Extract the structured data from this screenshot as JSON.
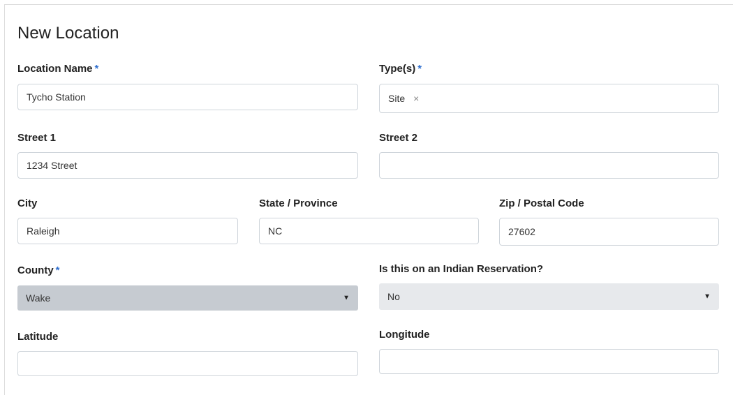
{
  "title": "New Location",
  "required_marker": "*",
  "fields": {
    "location_name": {
      "label": "Location Name",
      "value": "Tycho Station"
    },
    "types": {
      "label": "Type(s)",
      "tags": [
        {
          "label": "Site",
          "remove_icon": "×"
        }
      ]
    },
    "street1": {
      "label": "Street 1",
      "value": "1234 Street"
    },
    "street2": {
      "label": "Street 2",
      "value": ""
    },
    "city": {
      "label": "City",
      "value": "Raleigh"
    },
    "state": {
      "label": "State / Province",
      "value": "NC"
    },
    "zip": {
      "label": "Zip / Postal Code",
      "value": "27602"
    },
    "county": {
      "label": "County",
      "value": "Wake",
      "arrow": "▼",
      "bg_color": "#c6cbd1"
    },
    "reservation": {
      "label": "Is this on an Indian Reservation?",
      "value": "No",
      "arrow": "▼",
      "bg_color": "#e7e9ec"
    },
    "latitude": {
      "label": "Latitude",
      "value": ""
    },
    "longitude": {
      "label": "Longitude",
      "value": ""
    }
  },
  "colors": {
    "required_star": "#2f6fcf"
  }
}
